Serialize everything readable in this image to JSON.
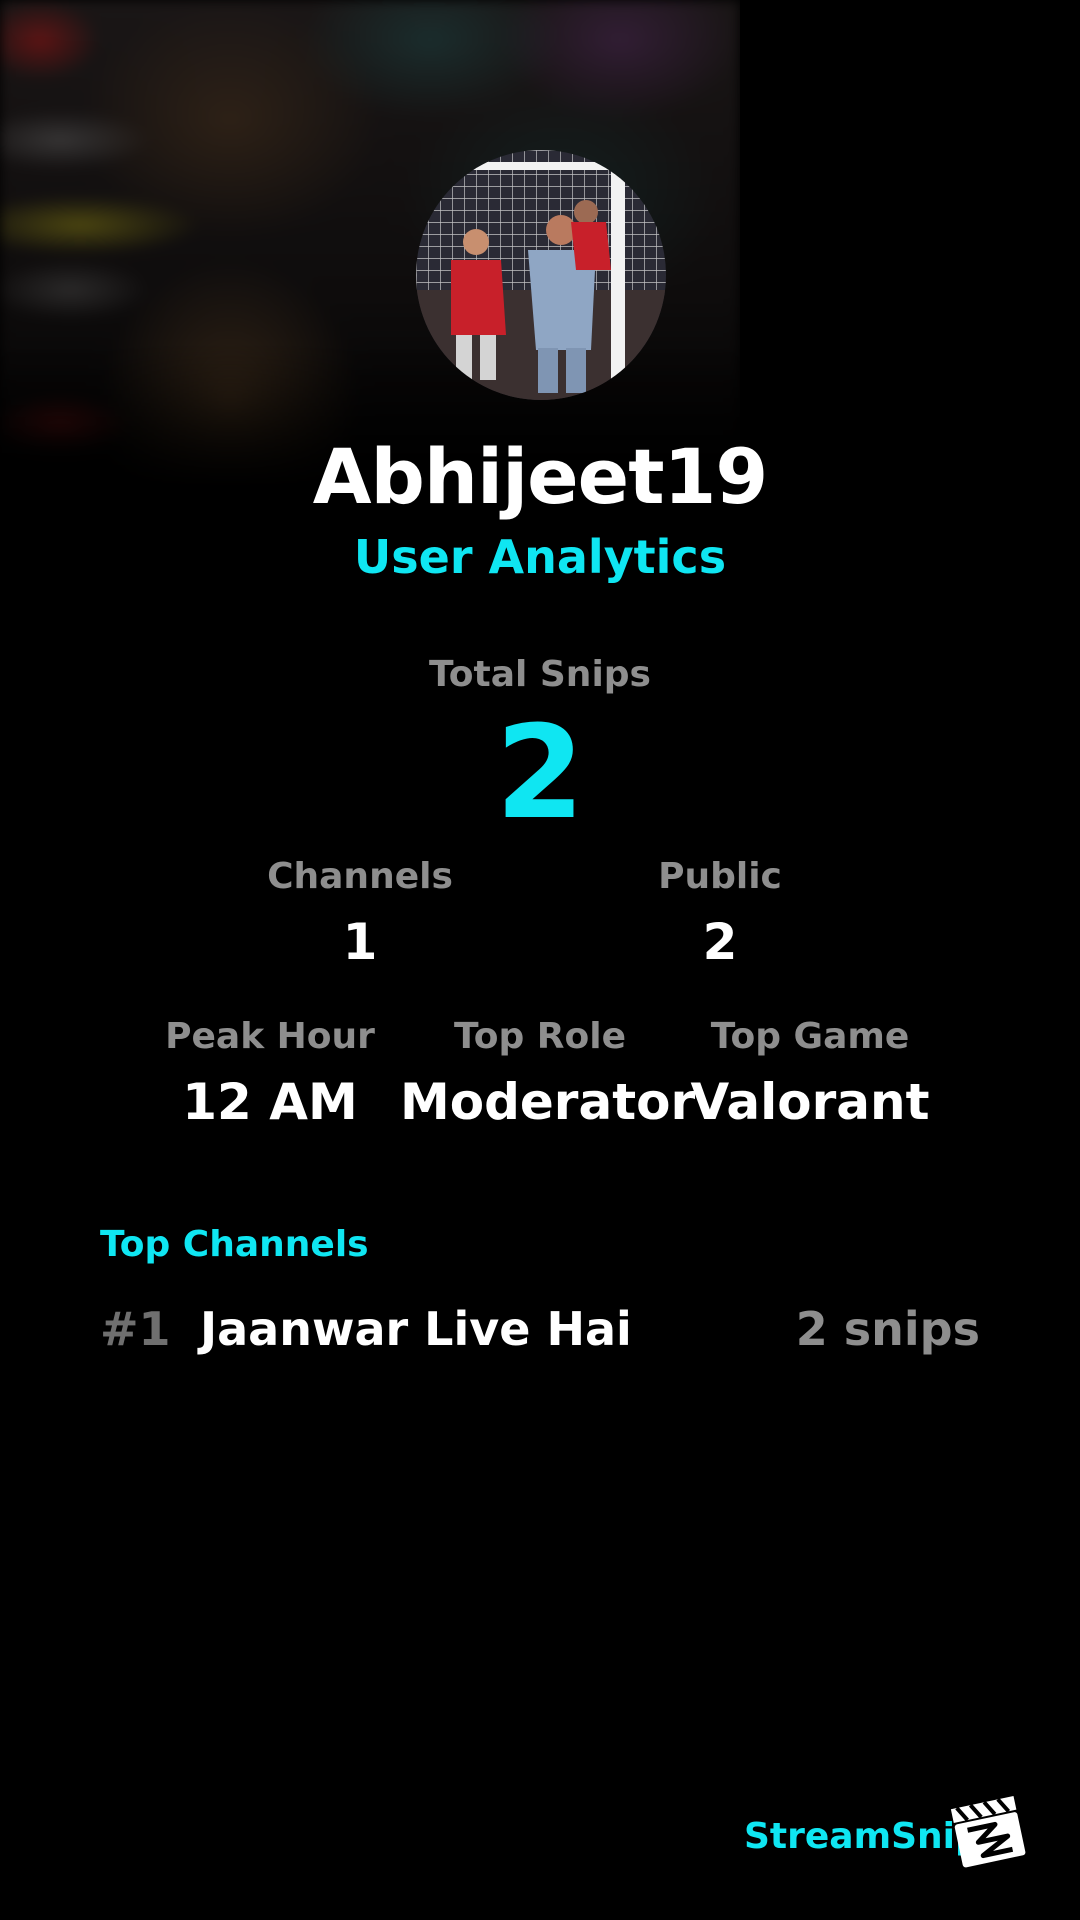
{
  "profile": {
    "username": "Abhijeet19",
    "subtitle": "User Analytics"
  },
  "stats": {
    "total_snips_label": "Total Snips",
    "total_snips_value": "2",
    "channels_label": "Channels",
    "channels_value": "1",
    "public_label": "Public",
    "public_value": "2",
    "peak_hour_label": "Peak Hour",
    "peak_hour_value": "12 AM",
    "top_role_label": "Top Role",
    "top_role_value": "Moderator",
    "top_game_label": "Top Game",
    "top_game_value": "Valorant"
  },
  "top_channels": {
    "title": "Top Channels",
    "items": [
      {
        "rank": "#1",
        "name": "Jaanwar Live Hai",
        "count": "2 snips"
      }
    ]
  },
  "branding": {
    "name": "StreamSnip",
    "logo_icon": "clapperboard-icon"
  },
  "colors": {
    "accent": "#0fe6f2",
    "label_gray": "#8e8e8e",
    "background": "#000000"
  }
}
